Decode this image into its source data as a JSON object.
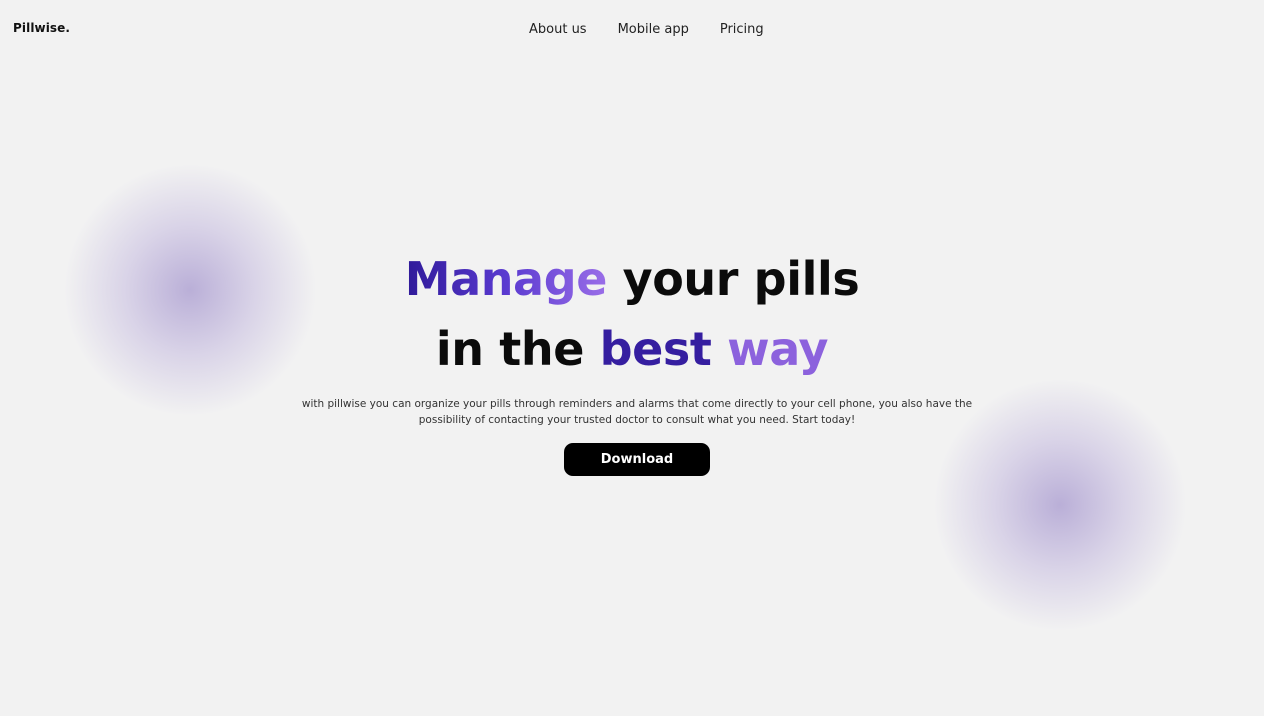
{
  "brand": {
    "name": "Pillwise."
  },
  "nav": {
    "items": [
      {
        "label": "About us"
      },
      {
        "label": "Mobile app"
      },
      {
        "label": "Pricing"
      }
    ]
  },
  "hero": {
    "line1": {
      "highlight": "Manage",
      "rest": " your pills"
    },
    "line2": {
      "lead": "in the ",
      "highlight1": "best",
      "gap": " ",
      "highlight2": "way"
    },
    "description": "with pillwise you can organize your pills through reminders and alarms that come directly to your cell phone, you also have the possibility of contacting your trusted doctor to consult what you need. Start today!",
    "cta_label": "Download"
  },
  "colors": {
    "background": "#f2f2f2",
    "accent_dark": "#351ea0",
    "accent_light": "#8c62dd",
    "button_bg": "#000000",
    "button_text": "#ffffff",
    "blob": "#b7aad8"
  }
}
